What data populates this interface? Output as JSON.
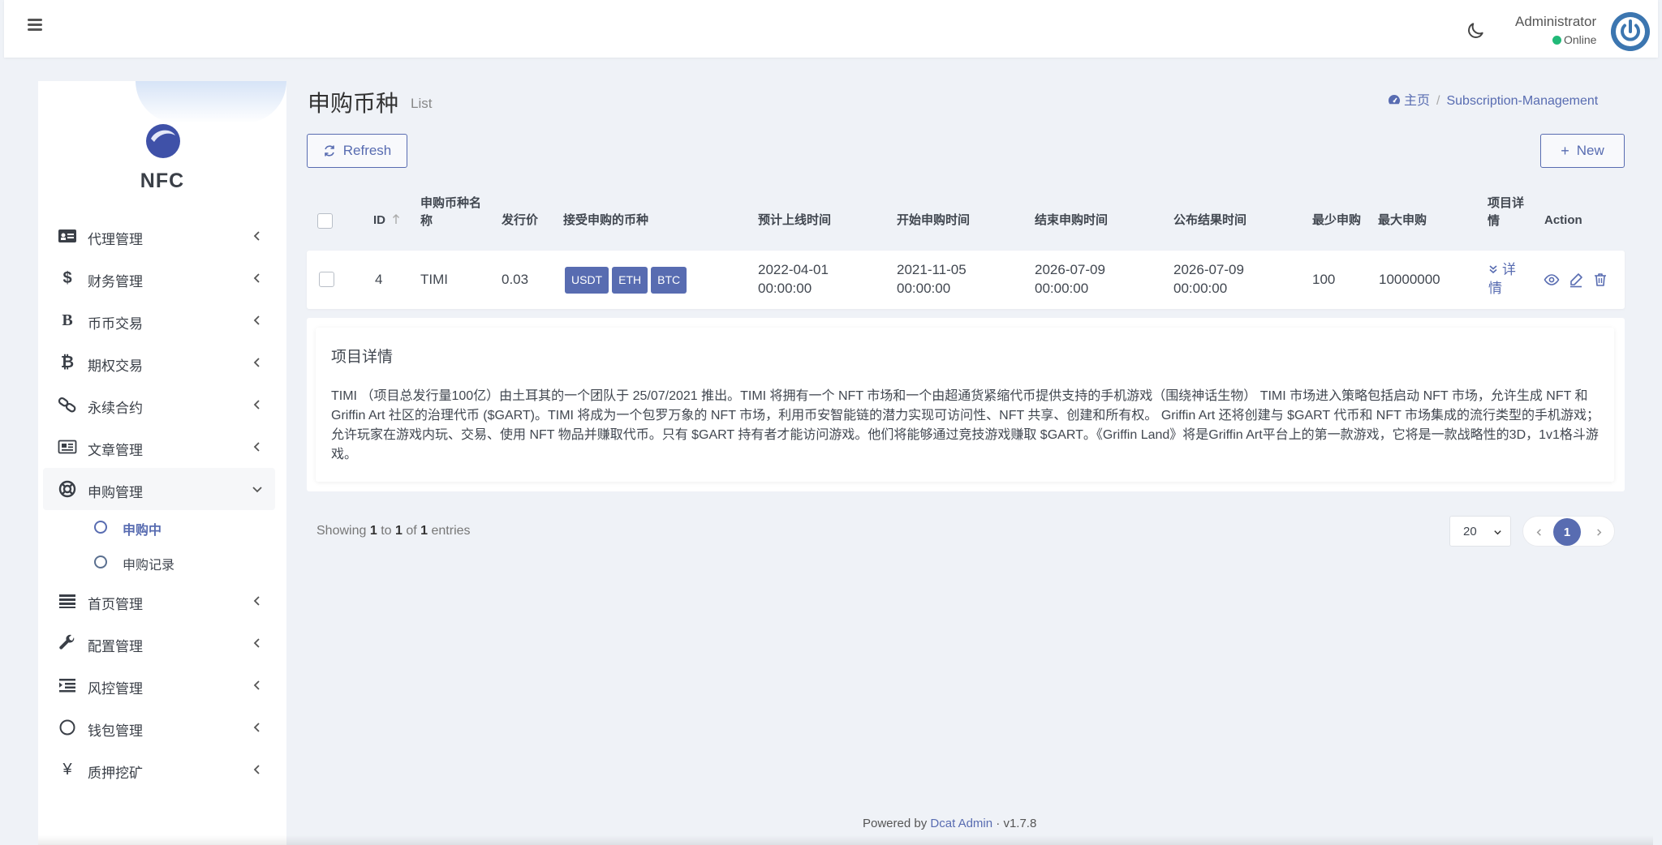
{
  "colors": {
    "primary": "#586cb1",
    "online": "#21b978",
    "background": "#eff2f7"
  },
  "header": {
    "user_name": "Administrator",
    "user_status": "Online",
    "icons": [
      "menu-icon",
      "moon-icon",
      "power-avatar-icon"
    ]
  },
  "sidebar": {
    "logo_text": "NFC",
    "items": [
      {
        "label": "代理管理",
        "icon": "id-card-icon"
      },
      {
        "label": "财务管理",
        "icon": "dollar-icon"
      },
      {
        "label": "币币交易",
        "icon": "letter-b-icon"
      },
      {
        "label": "期权交易",
        "icon": "bitcoin-icon"
      },
      {
        "label": "永续合约",
        "icon": "link-icon"
      },
      {
        "label": "文章管理",
        "icon": "newspaper-icon"
      },
      {
        "label": "申购管理",
        "icon": "lifebuoy-icon",
        "expanded": true
      },
      {
        "label": "首页管理",
        "icon": "list-icon"
      },
      {
        "label": "配置管理",
        "icon": "wrench-icon"
      },
      {
        "label": "风控管理",
        "icon": "indent-icon"
      },
      {
        "label": "钱包管理",
        "icon": "circle-icon"
      },
      {
        "label": "质押挖矿",
        "icon": "yen-icon"
      }
    ],
    "subitems": [
      {
        "label": "申购中",
        "current": true
      },
      {
        "label": "申购记录",
        "current": false
      }
    ]
  },
  "page": {
    "title": "申购币种",
    "subtitle": "List",
    "breadcrumb_home": "主页",
    "breadcrumb_current": "Subscription-Management",
    "refresh_label": "Refresh",
    "new_label": "New"
  },
  "table": {
    "headers": {
      "id": "ID",
      "name_line1": "申购币种名",
      "name_line2": "称",
      "price": "发行价",
      "accepted": "接受申购的币种",
      "online_time": "预计上线时间",
      "start_time": "开始申购时间",
      "end_time": "结束申购时间",
      "result_time": "公布结果时间",
      "min": "最少申购",
      "max": "最大申购",
      "detail_line1": "项目详",
      "detail_line2": "情",
      "action": "Action"
    },
    "row": {
      "id": "4",
      "name": "TIMI",
      "price": "0.03",
      "coins": [
        "USDT",
        "ETH",
        "BTC"
      ],
      "online_date": "2022-04-01",
      "online_clock": "00:00:00",
      "start_date": "2021-11-05",
      "start_clock": "00:00:00",
      "end_date": "2026-07-09",
      "end_clock": "00:00:00",
      "result_date": "2026-07-09",
      "result_clock": "00:00:00",
      "min": "100",
      "max": "10000000",
      "detail_link_line1": "详",
      "detail_link_line2": "情"
    },
    "detail": {
      "title": "项目详情",
      "text": "TIMI （项目总发行量100亿）由土耳其的一个团队于 25/07/2021 推出。TIMI 将拥有一个 NFT 市场和一个由超通货紧缩代币提供支持的手机游戏（围绕神话生物） TIMI 市场进入策略包括启动 NFT 市场，允许生成 NFT 和 Griffin Art 社区的治理代币 ($GART)。TIMI 将成为一个包罗万象的 NFT 市场，利用币安智能链的潜力实现可访问性、NFT 共享、创建和所有权。 Griffin Art 还将创建与 $GART 代币和 NFT 市场集成的流行类型的手机游戏；允许玩家在游戏内玩、交易、使用 NFT 物品并赚取代币。只有 $GART 持有者才能访问游戏。他们将能够通过竞技游戏赚取 $GART。《Griffin Land》将是Griffin Art平台上的第一款游戏，它将是一款战略性的3D，1v1格斗游戏。"
    }
  },
  "pagination": {
    "showing_prefix": "Showing",
    "from": "1",
    "to_word": "to",
    "to": "1",
    "of_word": "of",
    "total": "1",
    "entries_word": "entries",
    "per_page": "20",
    "current_page": "1"
  },
  "footer": {
    "prefix": "Powered by",
    "link": "Dcat Admin",
    "separator": "·",
    "version": "v1.7.8"
  }
}
